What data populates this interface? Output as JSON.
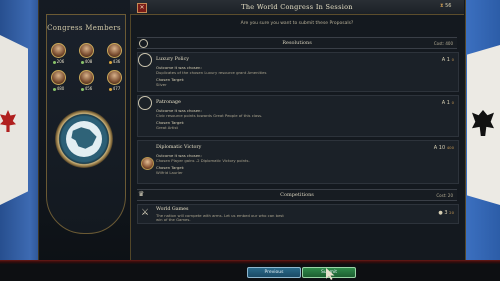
{
  "window": {
    "title": "The World Congress In Session",
    "close_label": "✕",
    "sessions_value": "56",
    "prompt": "Are you sure you want to submit these Proposals?"
  },
  "congress": {
    "title": "Congress Members",
    "members": [
      {
        "count": "206"
      },
      {
        "count": "408"
      },
      {
        "count": "436"
      },
      {
        "count": "480"
      },
      {
        "count": "456"
      },
      {
        "count": "477"
      }
    ]
  },
  "resolutions": {
    "header": "Resolutions",
    "cost_label": "Cost:",
    "cost_value": "400",
    "items": [
      {
        "name": "Luxury Policy",
        "outcome_heading": "Outcome it was chosen:",
        "outcome_text": "Duplicates of the chosen Luxury resource grant  Amenities",
        "target_heading": "Chosen Target:",
        "target_value": "Silver",
        "votes": "1",
        "vote_cost": "0"
      },
      {
        "name": "Patronage",
        "outcome_heading": "Outcome it was chosen:",
        "outcome_text": "Civic resource points towards   Great People of this class.",
        "target_heading": "Chosen Target:",
        "target_value": "Great Artist",
        "votes": "1",
        "vote_cost": "0"
      },
      {
        "name": "Diplomatic Victory",
        "outcome_heading": "Outcome it was chosen:",
        "outcome_text": "Chosen Player gains -2 Diplomatic Victory points.",
        "target_heading": "Chosen Target:",
        "target_value": "Wilfrid Laurier",
        "votes": "10",
        "vote_cost": "400"
      }
    ]
  },
  "competitions": {
    "header": "Competitions",
    "cost_label": "Cost:",
    "cost_value": "20",
    "items": [
      {
        "name": "World Games",
        "line1": "The nation will compete with arms. Let us embed our who can best",
        "line2": "win of the Games.",
        "votes": "3",
        "vote_cost": "20"
      }
    ]
  },
  "footer": {
    "previous_label": "Previous",
    "submit_label": "Submit"
  },
  "colors": {
    "accent_gold": "#c9a85a",
    "bottom_red": "#6b1c18",
    "submit_green": "#2f8a4a",
    "previous_blue": "#2a6a8a"
  }
}
